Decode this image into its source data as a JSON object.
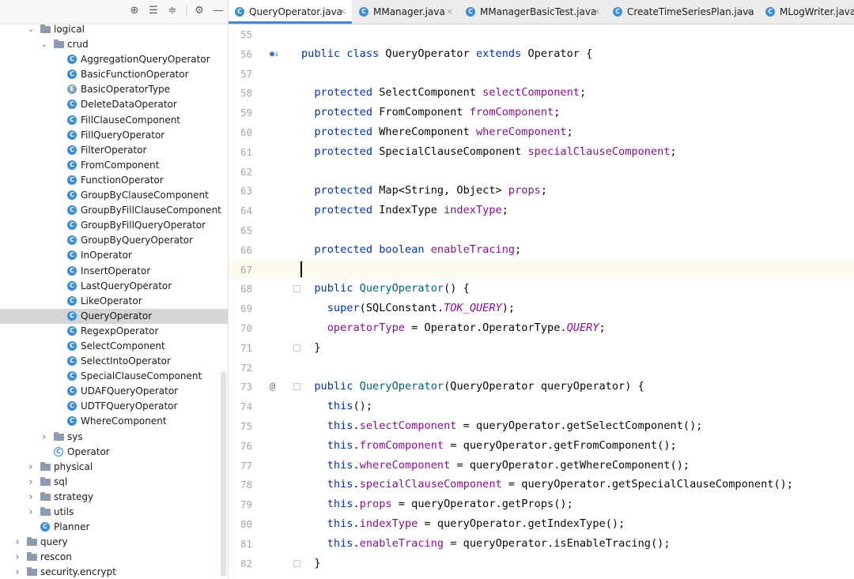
{
  "toolbar": {
    "icons": [
      "crosshair-icon",
      "collapse-all-icon",
      "expand-all-icon",
      "gear-icon",
      "minimize-icon"
    ],
    "glyphs": [
      "⊕",
      "☰",
      "≑",
      "⚙",
      "—"
    ]
  },
  "tree": [
    {
      "label": "logical",
      "depth": 2,
      "kind": "folder",
      "expanded": true
    },
    {
      "label": "crud",
      "depth": 3,
      "kind": "folder",
      "expanded": true
    },
    {
      "label": "AggregationQueryOperator",
      "depth": 4,
      "kind": "class"
    },
    {
      "label": "BasicFunctionOperator",
      "depth": 4,
      "kind": "class"
    },
    {
      "label": "BasicOperatorType",
      "depth": 4,
      "kind": "enum"
    },
    {
      "label": "DeleteDataOperator",
      "depth": 4,
      "kind": "class"
    },
    {
      "label": "FillClauseComponent",
      "depth": 4,
      "kind": "class"
    },
    {
      "label": "FillQueryOperator",
      "depth": 4,
      "kind": "class"
    },
    {
      "label": "FilterOperator",
      "depth": 4,
      "kind": "class"
    },
    {
      "label": "FromComponent",
      "depth": 4,
      "kind": "class"
    },
    {
      "label": "FunctionOperator",
      "depth": 4,
      "kind": "class"
    },
    {
      "label": "GroupByClauseComponent",
      "depth": 4,
      "kind": "class"
    },
    {
      "label": "GroupByFillClauseComponent",
      "depth": 4,
      "kind": "class"
    },
    {
      "label": "GroupByFillQueryOperator",
      "depth": 4,
      "kind": "class"
    },
    {
      "label": "GroupByQueryOperator",
      "depth": 4,
      "kind": "class"
    },
    {
      "label": "InOperator",
      "depth": 4,
      "kind": "class"
    },
    {
      "label": "InsertOperator",
      "depth": 4,
      "kind": "class"
    },
    {
      "label": "LastQueryOperator",
      "depth": 4,
      "kind": "class"
    },
    {
      "label": "LikeOperator",
      "depth": 4,
      "kind": "class"
    },
    {
      "label": "QueryOperator",
      "depth": 4,
      "kind": "class",
      "selected": true
    },
    {
      "label": "RegexpOperator",
      "depth": 4,
      "kind": "class"
    },
    {
      "label": "SelectComponent",
      "depth": 4,
      "kind": "class"
    },
    {
      "label": "SelectIntoOperator",
      "depth": 4,
      "kind": "class"
    },
    {
      "label": "SpecialClauseComponent",
      "depth": 4,
      "kind": "class"
    },
    {
      "label": "UDAFQueryOperator",
      "depth": 4,
      "kind": "class"
    },
    {
      "label": "UDTFQueryOperator",
      "depth": 4,
      "kind": "class"
    },
    {
      "label": "WhereComponent",
      "depth": 4,
      "kind": "class"
    },
    {
      "label": "sys",
      "depth": 3,
      "kind": "folder",
      "expanded": false
    },
    {
      "label": "Operator",
      "depth": 3,
      "kind": "abstract"
    },
    {
      "label": "physical",
      "depth": 2,
      "kind": "folder",
      "expanded": false
    },
    {
      "label": "sql",
      "depth": 2,
      "kind": "folder",
      "expanded": false
    },
    {
      "label": "strategy",
      "depth": 2,
      "kind": "folder",
      "expanded": false
    },
    {
      "label": "utils",
      "depth": 2,
      "kind": "folder",
      "expanded": false
    },
    {
      "label": "Planner",
      "depth": 2,
      "kind": "class"
    },
    {
      "label": "query",
      "depth": 1,
      "kind": "folder",
      "expanded": false
    },
    {
      "label": "rescon",
      "depth": 1,
      "kind": "folder",
      "expanded": false
    },
    {
      "label": "security.encrypt",
      "depth": 1,
      "kind": "folder",
      "expanded": false
    }
  ],
  "tabs": [
    {
      "label": "QueryOperator.java",
      "active": true,
      "icon": "C"
    },
    {
      "label": "MManager.java",
      "active": false,
      "icon": "C"
    },
    {
      "label": "MManagerBasicTest.java",
      "active": false,
      "icon": "C"
    },
    {
      "label": "CreateTimeSeriesPlan.java",
      "active": false,
      "icon": "C"
    },
    {
      "label": "MLogWriter.java",
      "active": false,
      "icon": "C"
    }
  ],
  "editor": {
    "lines": [
      {
        "n": "55",
        "tokens": []
      },
      {
        "n": "56",
        "mark": "●↓",
        "tokens": [
          [
            "kw",
            "public class "
          ],
          [
            "",
            "QueryOperator "
          ],
          [
            "kw",
            "extends "
          ],
          [
            "",
            "Operator {"
          ]
        ]
      },
      {
        "n": "57",
        "tokens": []
      },
      {
        "n": "58",
        "tokens": [
          [
            "",
            "  "
          ],
          [
            "kw",
            "protected "
          ],
          [
            "",
            "SelectComponent "
          ],
          [
            "fld",
            "selectComponent"
          ],
          [
            "",
            ";"
          ]
        ]
      },
      {
        "n": "59",
        "tokens": [
          [
            "",
            "  "
          ],
          [
            "kw",
            "protected "
          ],
          [
            "",
            "FromComponent "
          ],
          [
            "fld",
            "fromComponent"
          ],
          [
            "",
            ";"
          ]
        ]
      },
      {
        "n": "60",
        "tokens": [
          [
            "",
            "  "
          ],
          [
            "kw",
            "protected "
          ],
          [
            "",
            "WhereComponent "
          ],
          [
            "fld",
            "whereComponent"
          ],
          [
            "",
            ";"
          ]
        ]
      },
      {
        "n": "61",
        "tokens": [
          [
            "",
            "  "
          ],
          [
            "kw",
            "protected "
          ],
          [
            "",
            "SpecialClauseComponent "
          ],
          [
            "fld",
            "specialClauseComponent"
          ],
          [
            "",
            ";"
          ]
        ]
      },
      {
        "n": "62",
        "tokens": []
      },
      {
        "n": "63",
        "tokens": [
          [
            "",
            "  "
          ],
          [
            "kw",
            "protected "
          ],
          [
            "",
            "Map<String, Object> "
          ],
          [
            "fld",
            "props"
          ],
          [
            "",
            ";"
          ]
        ]
      },
      {
        "n": "64",
        "tokens": [
          [
            "",
            "  "
          ],
          [
            "kw",
            "protected "
          ],
          [
            "",
            "IndexType "
          ],
          [
            "fld",
            "indexType"
          ],
          [
            "",
            ";"
          ]
        ]
      },
      {
        "n": "65",
        "tokens": []
      },
      {
        "n": "66",
        "tokens": [
          [
            "",
            "  "
          ],
          [
            "kw",
            "protected boolean "
          ],
          [
            "fld",
            "enableTracing"
          ],
          [
            "",
            ";"
          ]
        ]
      },
      {
        "n": "67",
        "current": true,
        "caret": true,
        "tokens": []
      },
      {
        "n": "68",
        "fold": true,
        "tokens": [
          [
            "",
            "  "
          ],
          [
            "kw",
            "public "
          ],
          [
            "fn",
            "QueryOperator"
          ],
          [
            "",
            "() {"
          ]
        ]
      },
      {
        "n": "69",
        "tokens": [
          [
            "",
            "    "
          ],
          [
            "kw",
            "super"
          ],
          [
            "",
            "(SQLConstant."
          ],
          [
            "it",
            "TOK_QUERY"
          ],
          [
            "",
            ");"
          ]
        ]
      },
      {
        "n": "70",
        "tokens": [
          [
            "",
            "    "
          ],
          [
            "fld",
            "operatorType"
          ],
          [
            "",
            " = Operator.OperatorType."
          ],
          [
            "it",
            "QUERY"
          ],
          [
            "",
            ";"
          ]
        ]
      },
      {
        "n": "71",
        "fold": true,
        "tokens": [
          [
            "",
            "  }"
          ]
        ]
      },
      {
        "n": "72",
        "tokens": []
      },
      {
        "n": "73",
        "mark": "@",
        "fold": true,
        "tokens": [
          [
            "",
            "  "
          ],
          [
            "kw",
            "public "
          ],
          [
            "fn",
            "QueryOperator"
          ],
          [
            "",
            "(QueryOperator queryOperator) {"
          ]
        ]
      },
      {
        "n": "74",
        "tokens": [
          [
            "",
            "    "
          ],
          [
            "kw",
            "this"
          ],
          [
            "",
            "();"
          ]
        ]
      },
      {
        "n": "75",
        "tokens": [
          [
            "",
            "    "
          ],
          [
            "kw",
            "this"
          ],
          [
            "",
            "."
          ],
          [
            "fld",
            "selectComponent"
          ],
          [
            "",
            " = queryOperator.getSelectComponent();"
          ]
        ]
      },
      {
        "n": "76",
        "tokens": [
          [
            "",
            "    "
          ],
          [
            "kw",
            "this"
          ],
          [
            "",
            "."
          ],
          [
            "fld",
            "fromComponent"
          ],
          [
            "",
            " = queryOperator.getFromComponent();"
          ]
        ]
      },
      {
        "n": "77",
        "tokens": [
          [
            "",
            "    "
          ],
          [
            "kw",
            "this"
          ],
          [
            "",
            "."
          ],
          [
            "fld",
            "whereComponent"
          ],
          [
            "",
            " = queryOperator.getWhereComponent();"
          ]
        ]
      },
      {
        "n": "78",
        "tokens": [
          [
            "",
            "    "
          ],
          [
            "kw",
            "this"
          ],
          [
            "",
            "."
          ],
          [
            "fld",
            "specialClauseComponent"
          ],
          [
            "",
            " = queryOperator.getSpecialClauseComponent();"
          ]
        ]
      },
      {
        "n": "79",
        "tokens": [
          [
            "",
            "    "
          ],
          [
            "kw",
            "this"
          ],
          [
            "",
            "."
          ],
          [
            "fld",
            "props"
          ],
          [
            "",
            " = queryOperator.getProps();"
          ]
        ]
      },
      {
        "n": "80",
        "tokens": [
          [
            "",
            "    "
          ],
          [
            "kw",
            "this"
          ],
          [
            "",
            "."
          ],
          [
            "fld",
            "indexType"
          ],
          [
            "",
            " = queryOperator.getIndexType();"
          ]
        ]
      },
      {
        "n": "81",
        "tokens": [
          [
            "",
            "    "
          ],
          [
            "kw",
            "this"
          ],
          [
            "",
            "."
          ],
          [
            "fld",
            "enableTracing"
          ],
          [
            "",
            " = queryOperator.isEnableTracing();"
          ]
        ]
      },
      {
        "n": "82",
        "fold": true,
        "tokens": [
          [
            "",
            "  }"
          ]
        ]
      }
    ]
  },
  "colors": {
    "accent": "#4a88c7",
    "keyword": "#0033b3",
    "field": "#871094",
    "method": "#00627a",
    "selection": "#d5d5d5",
    "current_line": "#fcfaed"
  }
}
